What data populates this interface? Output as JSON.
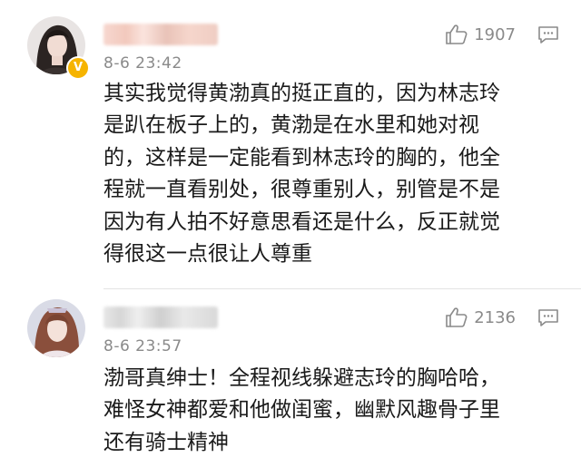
{
  "comments": [
    {
      "timestamp": "8-6 23:42",
      "likes": "1907",
      "verified_badge": "V",
      "lines": [
        "其实我觉得黄渤真的挺正直的，因为林志玲",
        "是趴在板子上的，黄渤是在水里和她对视",
        "的，这样是一定能看到林志玲的胸的，他全",
        "程就一直看别处，很尊重别人，别管是不是",
        "因为有人拍不好意思看还是什么，反正就觉",
        "得很这一点很让人尊重"
      ]
    },
    {
      "timestamp": "8-6 23:57",
      "likes": "2136",
      "lines": [
        "渤哥真绅士！全程视线躲避志玲的胸哈哈，",
        "难怪女神都爱和他做闺蜜，幽默风趣骨子里",
        "还有骑士精神"
      ]
    }
  ],
  "colors": {
    "meta_text": "#8a8a8a",
    "body_text": "#1a1a1a",
    "verified_badge": "#f6b400",
    "divider": "#e4e4e4"
  },
  "icons": [
    "thumbs-up-icon",
    "reply-icon",
    "verified-badge-icon"
  ]
}
